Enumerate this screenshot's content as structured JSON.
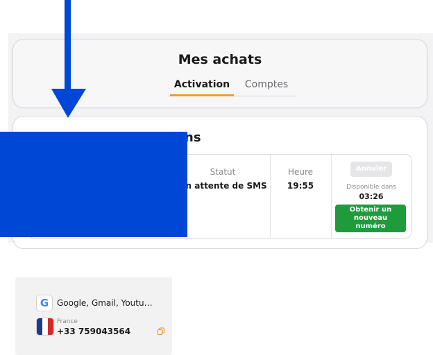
{
  "header": {
    "title": "Mes achats",
    "tabs": [
      {
        "label": "Activation",
        "active": true
      },
      {
        "label": "Comptes",
        "active": false
      }
    ]
  },
  "section": {
    "title_visible_part": "ns"
  },
  "order": {
    "service": {
      "name": "Google, Gmail, Youtu…",
      "icon": "google-icon"
    },
    "country": "France",
    "phone": "+33 759043564",
    "status_label": "Statut",
    "status_value": "En attente de SMS",
    "time_label": "Heure",
    "time_value": "19:55",
    "cancel_label": "Annuler",
    "available_label": "Disponible dans",
    "timer": "03:26",
    "new_number_lines": [
      "Obtenir un",
      "nouveau",
      "numéro"
    ]
  },
  "colors": {
    "accent": "#f39a32",
    "success": "#1f9b3c",
    "highlight": "#0047d6"
  }
}
